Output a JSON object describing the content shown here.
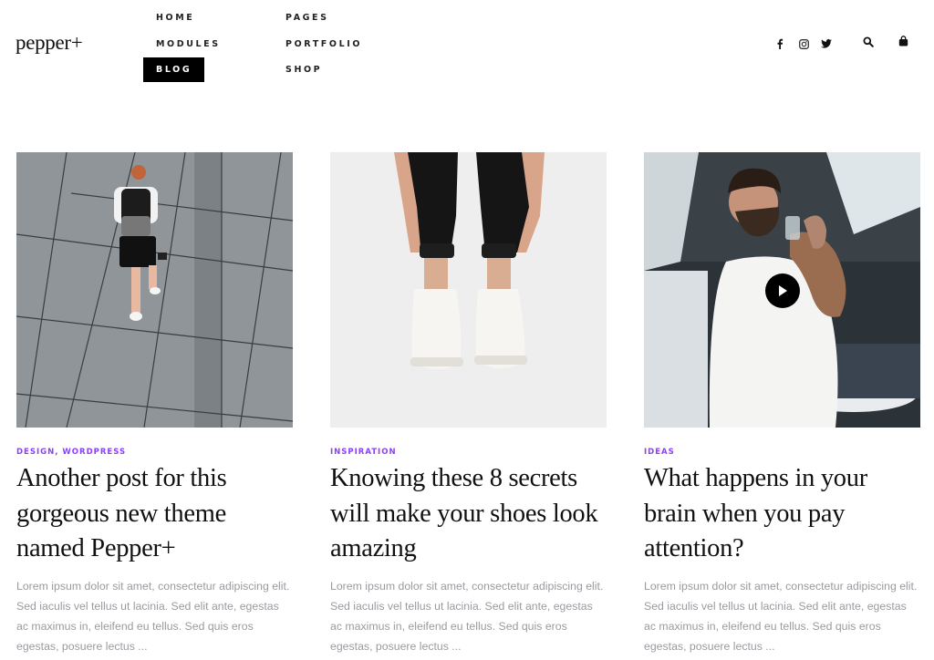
{
  "brand": {
    "logo": "pepper+"
  },
  "nav": {
    "items": [
      {
        "label": "HOME"
      },
      {
        "label": "MODULES"
      },
      {
        "label": "BLOG",
        "active": true
      },
      {
        "label": "PAGES"
      },
      {
        "label": "PORTFOLIO"
      },
      {
        "label": "SHOP"
      }
    ]
  },
  "header_icons": {
    "social": [
      "facebook-icon",
      "instagram-icon",
      "twitter-icon"
    ],
    "utility": [
      "search-icon",
      "shopping-bag-icon"
    ]
  },
  "colors": {
    "accent": "#8a3ffc",
    "text": "#111111",
    "muted": "#9a9aa0",
    "active_nav_bg": "#000000"
  },
  "posts": [
    {
      "categories": [
        "DESIGN",
        "WORDPRESS"
      ],
      "category_text": "DESIGN, WORDPRESS",
      "title": "Another post for this gorgeous new theme named Pepper+",
      "excerpt": "Lorem ipsum dolor sit amet, consectetur adipiscing elit. Sed iaculis vel tellus ut lacinia. Sed elit ante, egestas ac maximus in, eleifend eu tellus. Sed quis eros egestas, posuere lectus ...",
      "image": "man-walking-on-tiles",
      "video": false
    },
    {
      "categories": [
        "INSPIRATION"
      ],
      "category_text": "INSPIRATION",
      "title": "Knowing these 8 secrets will make your shoes look amazing",
      "excerpt": "Lorem ipsum dolor sit amet, consectetur adipiscing elit. Sed iaculis vel tellus ut lacinia. Sed elit ante, egestas ac maximus in, eleifend eu tellus. Sed quis eros egestas, posuere lectus ...",
      "image": "white-sneakers",
      "video": false
    },
    {
      "categories": [
        "IDEAS"
      ],
      "category_text": "IDEAS",
      "title": "What happens in your brain when you pay attention?",
      "excerpt": "Lorem ipsum dolor sit amet, consectetur adipiscing elit. Sed iaculis vel tellus ut lacinia. Sed elit ante, egestas ac maximus in, eleifend eu tellus. Sed quis eros egestas, posuere lectus ...",
      "image": "tattooed-man-drinking",
      "video": true
    }
  ]
}
